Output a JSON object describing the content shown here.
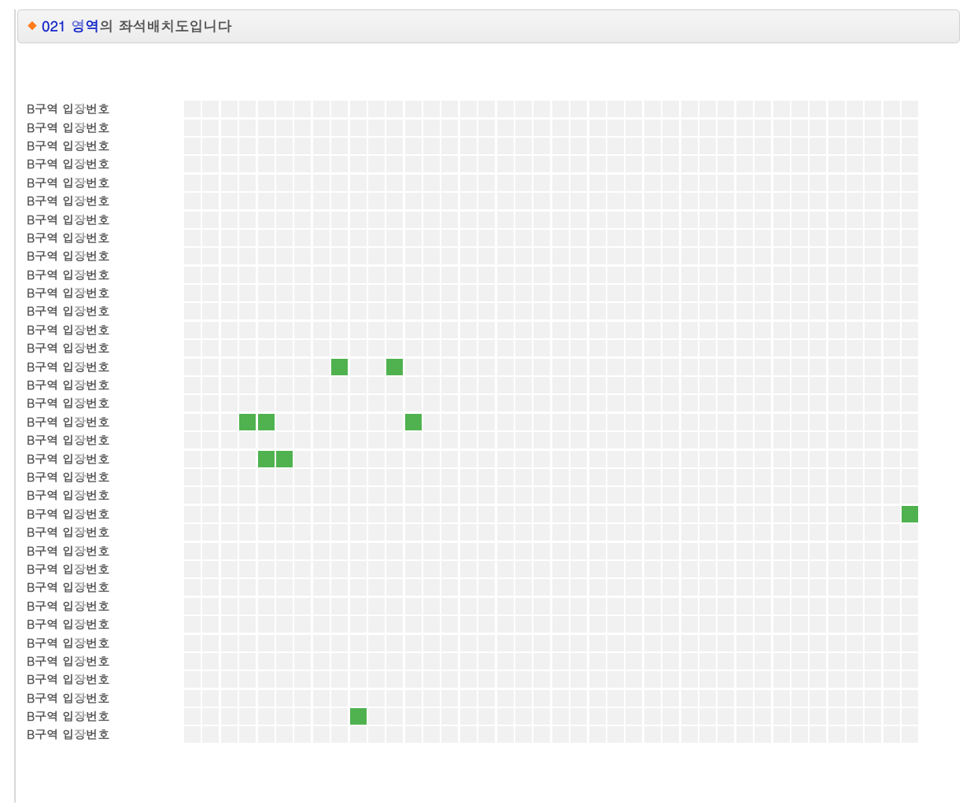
{
  "header": {
    "diamond": "◆",
    "area_code": "021",
    "area_suffix": " 영역",
    "title_rest": "의 좌석배치도입니다"
  },
  "row_label": "B구역 입장번호",
  "num_rows": 35,
  "num_cols": 40,
  "seat_colors": {
    "empty": "#f1f1f1",
    "available": "#4fb24f"
  },
  "available_seats": [
    {
      "row": 14,
      "col": 8
    },
    {
      "row": 14,
      "col": 11
    },
    {
      "row": 17,
      "col": 3
    },
    {
      "row": 17,
      "col": 4
    },
    {
      "row": 17,
      "col": 12
    },
    {
      "row": 19,
      "col": 4
    },
    {
      "row": 19,
      "col": 5
    },
    {
      "row": 22,
      "col": 39
    },
    {
      "row": 33,
      "col": 9
    }
  ]
}
